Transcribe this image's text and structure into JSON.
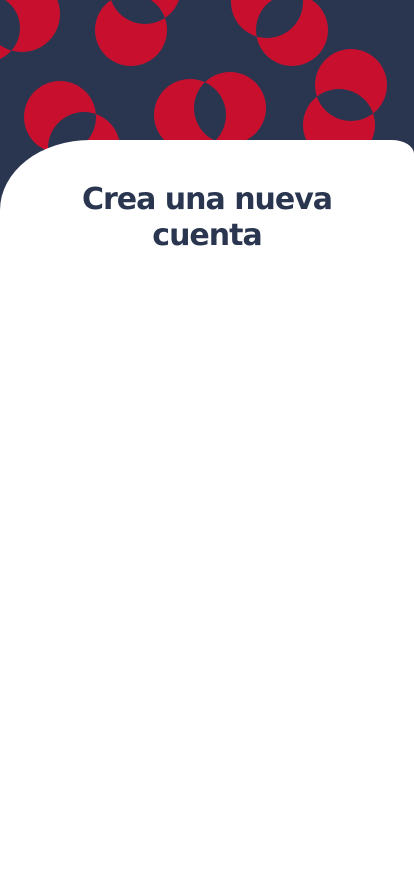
{
  "header": {
    "title": "Crea una nueva cuenta"
  },
  "colors": {
    "background_navy": "#2a3650",
    "circle_red": "#c8102e",
    "sheet_white": "#ffffff"
  },
  "decoration": {
    "pattern": "overlapping-circles"
  }
}
